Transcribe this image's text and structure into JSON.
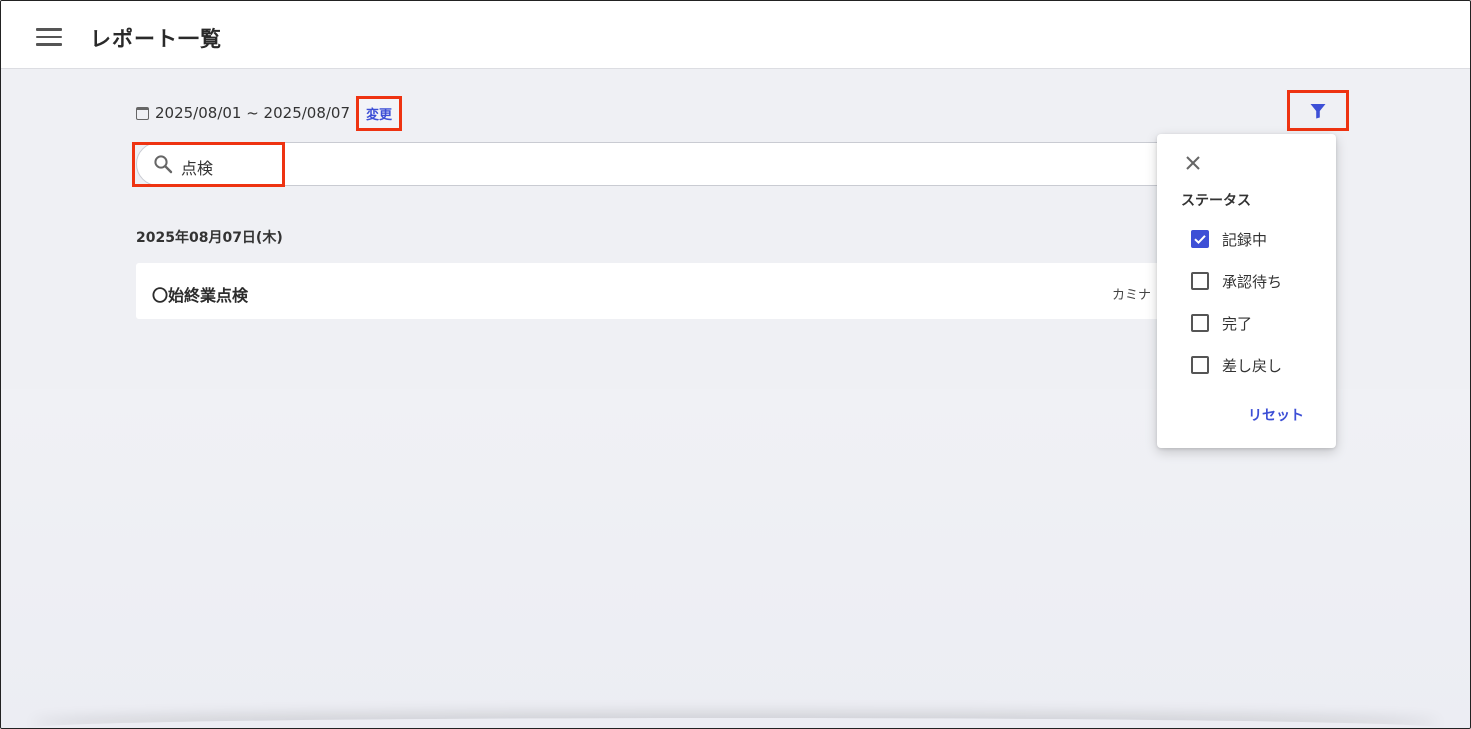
{
  "header": {
    "title": "レポート一覧"
  },
  "date_filter": {
    "range": "2025/08/01 ~ 2025/08/07",
    "change_label": "変更"
  },
  "search": {
    "value": "点検"
  },
  "reports": {
    "date_heading": "2025年08月07日(木)",
    "items": [
      {
        "title": "〇始終業点検",
        "user": "カミナ"
      }
    ]
  },
  "filter_panel": {
    "title": "ステータス",
    "options": [
      {
        "label": "記録中",
        "checked": true
      },
      {
        "label": "承認待ち",
        "checked": false
      },
      {
        "label": "完了",
        "checked": false
      },
      {
        "label": "差し戻し",
        "checked": false
      }
    ],
    "reset_label": "リセット"
  },
  "colors": {
    "accent": "#3d4fd6",
    "highlight": "#ee3311",
    "background": "#eff0f4"
  },
  "icons": [
    "hamburger-menu-icon",
    "calendar-icon",
    "filter-funnel-icon",
    "search-icon",
    "close-icon",
    "checkmark-icon"
  ]
}
